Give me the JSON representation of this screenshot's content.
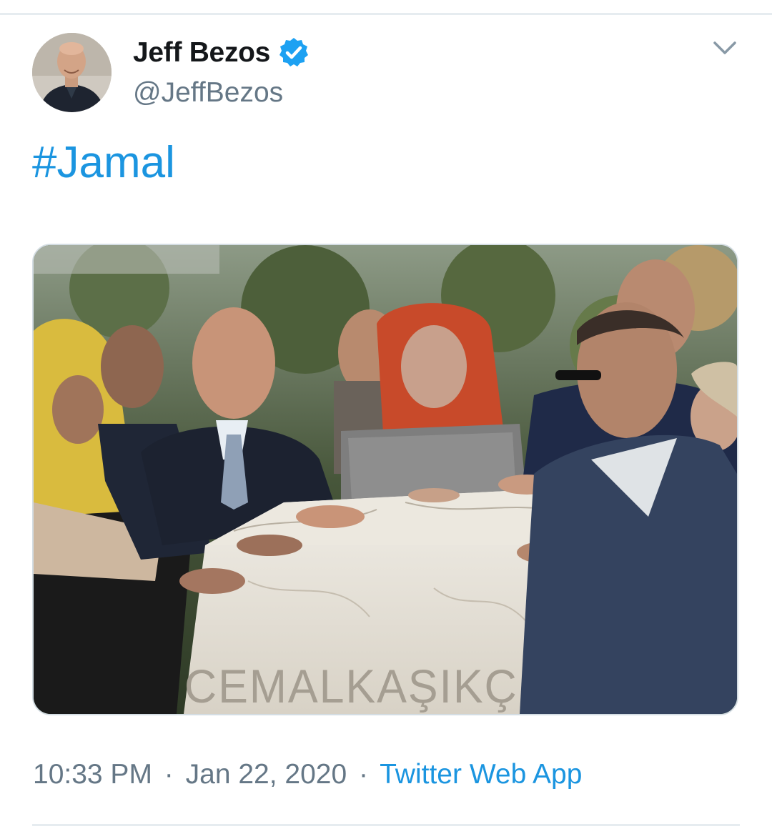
{
  "tweet": {
    "author": {
      "display_name": "Jeff Bezos",
      "handle": "@JeffBezos",
      "verified": true,
      "avatar_icon": "profile-photo"
    },
    "text": "#Jamal",
    "media": {
      "inscription": "CEMALKAŞIKÇI"
    },
    "time": "10:33 PM",
    "date": "Jan 22, 2020",
    "separator": "·",
    "source": "Twitter Web App"
  },
  "colors": {
    "link": "#1b95e0",
    "secondary_text": "#657786",
    "primary_text": "#14171a",
    "verified_badge": "#1da1f2"
  },
  "icons": {
    "menu": "chevron-down-icon",
    "verified": "verified-badge-icon"
  }
}
